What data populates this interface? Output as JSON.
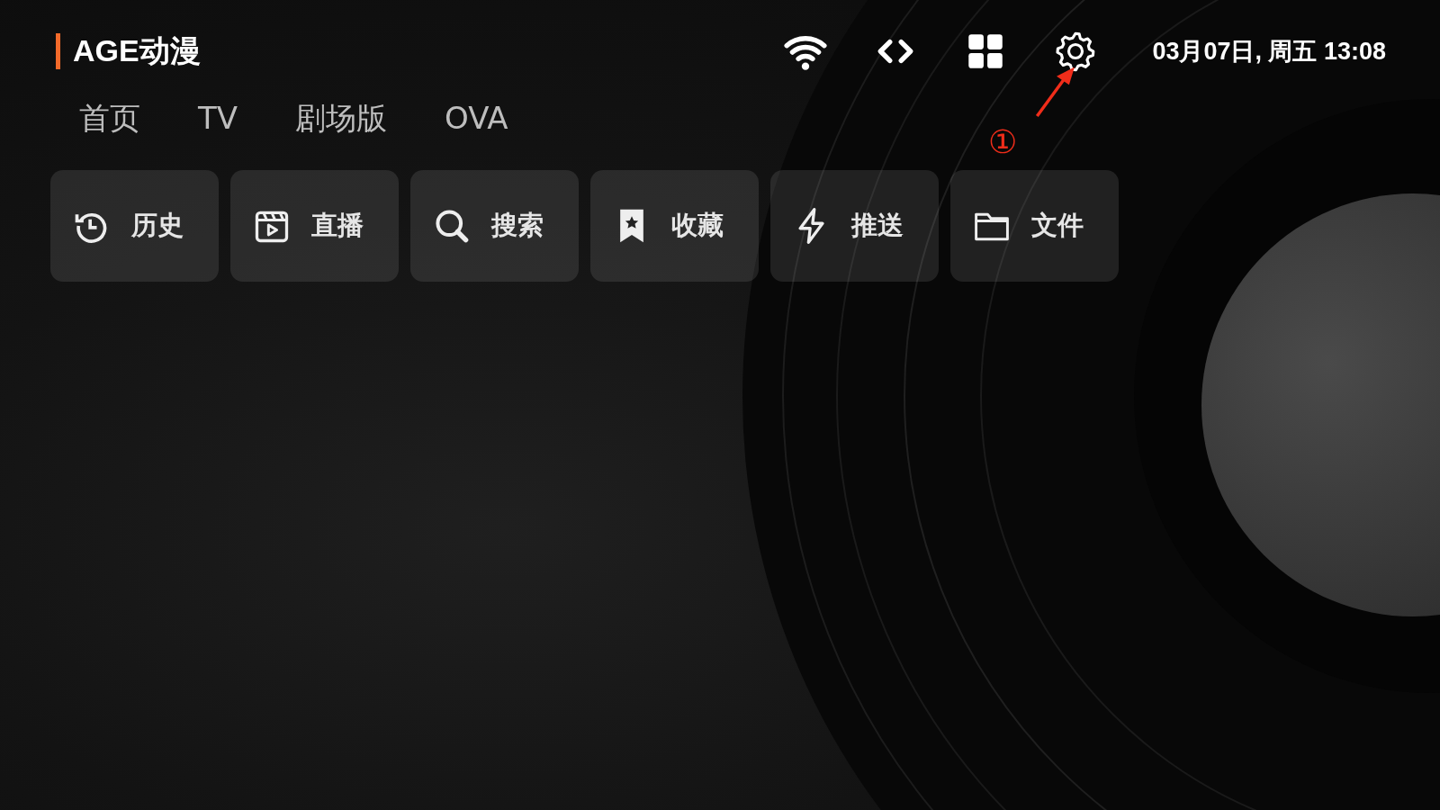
{
  "app_title": "AGE动漫",
  "datetime": "03月07日, 周五 13:08",
  "tabs": [
    {
      "label": "首页",
      "selected": false
    },
    {
      "label": "TV",
      "selected": false
    },
    {
      "label": "剧场版",
      "selected": false
    },
    {
      "label": "OVA",
      "selected": false
    }
  ],
  "tiles": [
    {
      "label": "历史"
    },
    {
      "label": "直播"
    },
    {
      "label": "搜索"
    },
    {
      "label": "收藏"
    },
    {
      "label": "推送"
    },
    {
      "label": "文件"
    }
  ],
  "annotation": {
    "label": "①"
  }
}
